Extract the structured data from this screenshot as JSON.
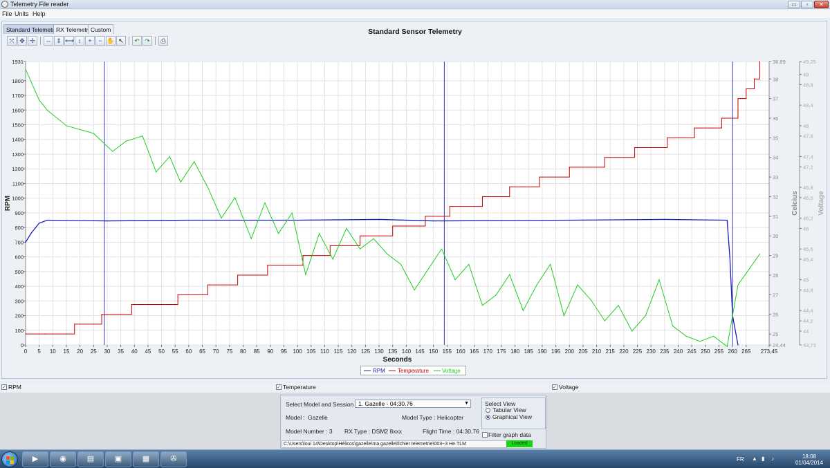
{
  "window": {
    "title": "Telemetry File reader",
    "controls": [
      "▭",
      "▫",
      "✕"
    ]
  },
  "menu": {
    "items": [
      "File",
      "Units",
      "Help"
    ]
  },
  "tabs": [
    "Standard Telemetry",
    "RX Telemetry",
    "Custom"
  ],
  "toolbar_icons": [
    "zoom-fit-icon",
    "pan-left-icon",
    "pan-right-icon",
    "zoom-x-icon",
    "zoom-y-icon",
    "fit-horizontal-icon",
    "fit-vertical-icon",
    "zoom-in-icon",
    "zoom-out-icon",
    "hand-icon",
    "pointer-icon",
    "undo-icon",
    "redo-icon",
    "print-icon"
  ],
  "chart_data": {
    "type": "line",
    "title": "Standard Sensor Telemetry",
    "xlabel": "Seconds",
    "xlim": [
      0,
      273.45
    ],
    "x_ticks": [
      "0",
      "5",
      "10",
      "15",
      "20",
      "25",
      "30",
      "35",
      "40",
      "45",
      "50",
      "55",
      "60",
      "65",
      "70",
      "75",
      "80",
      "85",
      "90",
      "95",
      "100",
      "105",
      "110",
      "115",
      "120",
      "125",
      "130",
      "135",
      "140",
      "145",
      "150",
      "155",
      "160",
      "165",
      "170",
      "175",
      "180",
      "185",
      "190",
      "195",
      "200",
      "205",
      "210",
      "215",
      "220",
      "225",
      "230",
      "235",
      "240",
      "245",
      "250",
      "255",
      "260",
      "265",
      "273,45"
    ],
    "y_axes": [
      {
        "label": "RPM",
        "side": "left",
        "lim": [
          0,
          1931
        ],
        "ticks": [
          "1931",
          "1800",
          "1700",
          "1600",
          "1500",
          "1400",
          "1300",
          "1200",
          "1100",
          "1000",
          "900",
          "800",
          "700",
          "600",
          "500",
          "400",
          "300",
          "200",
          "100",
          "0"
        ]
      },
      {
        "label": "Celcius",
        "side": "right",
        "lim": [
          24.44,
          38.89
        ],
        "ticks": [
          "38,89",
          "38",
          "37",
          "36",
          "35",
          "34",
          "33",
          "32",
          "31",
          "30",
          "29",
          "28",
          "27",
          "26",
          "25",
          "24,44"
        ]
      },
      {
        "label": "Voltage",
        "side": "right",
        "lim": [
          43.73,
          49.25
        ],
        "ticks": [
          "49,25",
          "49",
          "48,8",
          "48,4",
          "48",
          "47,8",
          "47,4",
          "47,2",
          "46,8",
          "46,6",
          "46,2",
          "46",
          "45,6",
          "45,4",
          "45",
          "44,8",
          "44,4",
          "44,2",
          "44",
          "43,73"
        ]
      }
    ],
    "legend_placement": "bottom-center",
    "grid": true,
    "series": [
      {
        "name": "RPM",
        "axis": "RPM",
        "color": "#1b1bb8",
        "x": [
          0,
          2,
          5,
          8,
          30,
          60,
          100,
          130,
          150,
          200,
          235,
          258,
          259,
          260,
          262
        ],
        "y": [
          700,
          760,
          830,
          850,
          845,
          850,
          850,
          855,
          845,
          850,
          855,
          850,
          600,
          200,
          0
        ]
      },
      {
        "name": "Temperature",
        "axis": "Celcius",
        "color": "#c00000",
        "x": [
          0,
          7,
          18,
          28,
          39,
          56,
          67,
          78,
          89,
          102,
          112,
          123,
          135,
          147,
          156,
          168,
          178,
          189,
          200,
          213,
          224,
          236,
          246,
          256,
          262,
          265,
          268,
          270
        ],
        "y": [
          25,
          25,
          25.5,
          26,
          26.5,
          27,
          27.5,
          28,
          28.5,
          29,
          29.5,
          30,
          30.5,
          31,
          31.5,
          32,
          32.5,
          33,
          33.5,
          34,
          34.5,
          35,
          35.5,
          36,
          37,
          37.5,
          38,
          38.89
        ]
      },
      {
        "name": "Voltage",
        "axis": "Voltage",
        "color": "#22cc22",
        "x": [
          0,
          5,
          8,
          15,
          25,
          32,
          37,
          43,
          48,
          53,
          57,
          62,
          67,
          72,
          77,
          83,
          88,
          93,
          98,
          103,
          108,
          113,
          118,
          123,
          128,
          133,
          138,
          143,
          148,
          153,
          158,
          163,
          168,
          173,
          178,
          183,
          188,
          193,
          198,
          203,
          208,
          213,
          218,
          223,
          228,
          233,
          238,
          243,
          248,
          253,
          258,
          262,
          266,
          270
        ],
        "y": [
          49.1,
          48.5,
          48.3,
          48,
          47.85,
          47.5,
          47.7,
          47.8,
          47.1,
          47.4,
          46.9,
          47.3,
          46.8,
          46.2,
          46.6,
          45.8,
          46.5,
          45.9,
          46.3,
          45.1,
          45.9,
          45.4,
          46.0,
          45.6,
          45.8,
          45.5,
          45.3,
          44.8,
          45.2,
          45.6,
          45.0,
          45.3,
          44.5,
          44.7,
          45.1,
          44.4,
          44.9,
          45.3,
          44.3,
          44.9,
          44.6,
          44.2,
          44.5,
          44.0,
          44.3,
          45.0,
          44.1,
          43.9,
          43.8,
          43.9,
          43.7,
          44.9,
          45.2,
          45.5
        ]
      }
    ]
  },
  "legend": [
    "RPM",
    "Temperature",
    "Voltage"
  ],
  "series_toggles": [
    {
      "label": "RPM",
      "checked": true
    },
    {
      "label": "Temperature",
      "checked": true
    },
    {
      "label": "Voltage",
      "checked": true
    }
  ],
  "session": {
    "select_label": "Select Model and Session",
    "selected": "1.   Gazelle - 04:30.76",
    "model_label": "Model :",
    "model_value": "Gazelle",
    "model_type": "Model Type : Helicopter",
    "model_number": "Model Number : 3",
    "rx_type": "RX Type : DSM2 8xxx",
    "flight_time": "Flight Time : 04:30.76",
    "filter_label": "Filter graph data",
    "file_path": "C:\\Users\\loui 14\\Desktop\\Hélicos\\gazelle\\ma gazelle\\fichier telemetrie\\003~3 He.TLM",
    "status": "Loaded"
  },
  "select_view": {
    "title": "Select View",
    "options": [
      "Tabular View",
      "Graphical View"
    ],
    "selected": "Graphical View"
  },
  "tray": {
    "lang": "FR",
    "time": "18:08",
    "date": "01/04/2014"
  }
}
